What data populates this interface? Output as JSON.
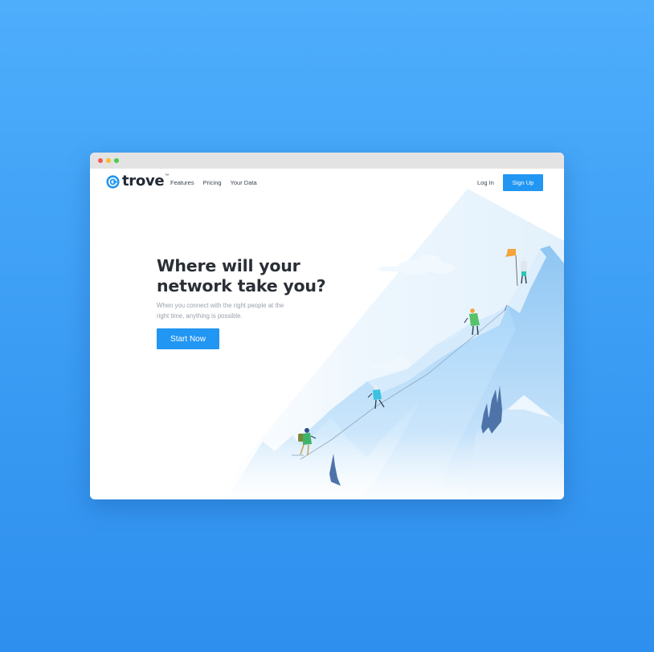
{
  "window": {
    "controls": [
      "close",
      "minimize",
      "maximize"
    ]
  },
  "nav": {
    "logo_text": "trove",
    "logo_mark": "trademark",
    "links": [
      "Features",
      "Pricing",
      "Your Data"
    ],
    "login_label": "Log In",
    "signup_label": "Sign Up"
  },
  "hero": {
    "title_line1": "Where will your",
    "title_line2": "network take you?",
    "subtitle": "When you connect with the right people at the right time, anything is possible.",
    "cta_label": "Start Now"
  },
  "illustration": {
    "subject": "mountain-climbers-illustration",
    "flag_color": "#f5a33a"
  },
  "colors": {
    "background": "#3d9ff5",
    "accent": "#2196f3",
    "heading": "#2a2f36",
    "muted_text": "#9aa1a9"
  }
}
